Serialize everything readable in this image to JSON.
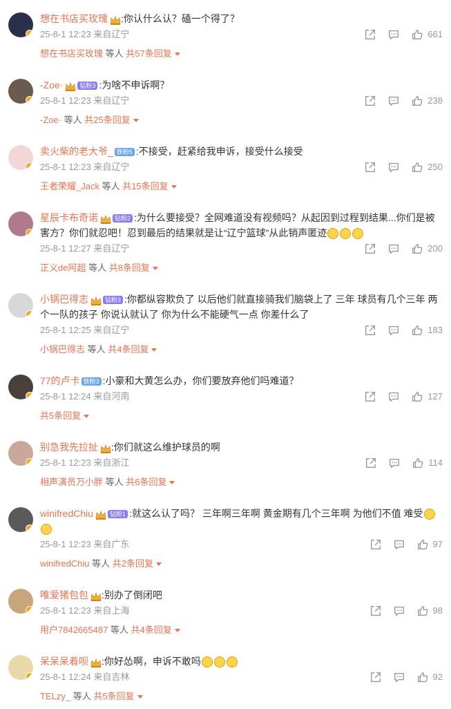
{
  "comments": [
    {
      "user": "想在书店买玫瑰",
      "badge": "",
      "crown": true,
      "text": ":你认什么认？磕一个得了？",
      "emoji_count": 0,
      "meta": "25-8-1 12:23 来自辽宁",
      "likes": "661",
      "reply_user": "想在书店买玫瑰",
      "reply_mid": " 等人 ",
      "reply_count": "共57条回复",
      "avatar_color": "#2a2f4a"
    },
    {
      "user": "-Zoe·",
      "badge": "钻粉3",
      "crown": true,
      "text": ":为啥不申诉啊？",
      "emoji_count": 0,
      "meta": "25-8-1 12:23 来自辽宁",
      "likes": "238",
      "reply_user": "-Zoe·",
      "reply_mid": " 等人 ",
      "reply_count": "共25条回复",
      "avatar_color": "#6b5a4e"
    },
    {
      "user": "卖火柴的老大爷_",
      "badge": "铁粉5",
      "crown": false,
      "text": ":不接受，赶紧给我申诉，接受什么接受",
      "emoji_count": 0,
      "meta": "25-8-1 12:23 来自辽宁",
      "likes": "250",
      "reply_user": "王者荣耀_Jack",
      "reply_mid": " 等人 ",
      "reply_count": "共15条回复",
      "avatar_color": "#f3d6d6"
    },
    {
      "user": "星辰卡布奇诺",
      "badge": "钻粉2",
      "crown": true,
      "text": ":为什么要接受？全网难道没有视频吗？从起因到过程到结果...你们是被害方？你们就忍吧！忍到最后的结果就是让“辽宁篮球”从此销声匿迹",
      "emoji_count": 3,
      "meta": "25-8-1 12:27 来自辽宁",
      "likes": "200",
      "reply_user": "正义de阿超",
      "reply_mid": " 等人 ",
      "reply_count": "共8条回复",
      "avatar_color": "#b07a8e"
    },
    {
      "user": "小锅巴得志",
      "badge": "钻粉3",
      "crown": true,
      "text": ":你都纵容欺负了 以后他们就直接骑我们脑袋上了 三年 球员有几个三年 两个一队的孩子 你说认就认了 你为什么不能硬气一点 你差什么了",
      "emoji_count": 0,
      "meta": "25-8-1 12:25 来自辽宁",
      "likes": "183",
      "reply_user": "小锅巴得志",
      "reply_mid": " 等人 ",
      "reply_count": "共4条回复",
      "avatar_color": "#d8d8d8"
    },
    {
      "user": "77的卢卡",
      "badge": "铁粉3",
      "crown": false,
      "text": ":小豪和大黄怎么办，你们要放弃他们吗难道？",
      "emoji_count": 0,
      "meta": "25-8-1 12:24 来自河南",
      "likes": "127",
      "reply_user": "",
      "reply_mid": "",
      "reply_count": "共5条回复",
      "avatar_color": "#4a3f3a"
    },
    {
      "user": "别急我先拉扯",
      "badge": "",
      "crown": true,
      "text": ":你们就这么维护球员的啊",
      "emoji_count": 0,
      "meta": "25-8-1 12:23 来自浙江",
      "likes": "114",
      "reply_user": "相声演员万小胖",
      "reply_mid": " 等人 ",
      "reply_count": "共6条回复",
      "avatar_color": "#c9a89a"
    },
    {
      "user": "winifredChiu",
      "badge": "钻粉1",
      "crown": true,
      "text": ":就这么认了吗？ 三年啊三年啊 黄金期有几个三年啊 为他们不值 难受",
      "emoji_count": 2,
      "meta": "25-8-1 12:23 来自广东",
      "likes": "97",
      "reply_user": "winifredChiu",
      "reply_mid": " 等人 ",
      "reply_count": "共2条回复",
      "avatar_color": "#5a5a5a"
    },
    {
      "user": "唯爱猪包包",
      "badge": "",
      "crown": true,
      "text": ":别办了倒闭吧",
      "emoji_count": 0,
      "meta": "25-8-1 12:23 来自上海",
      "likes": "98",
      "reply_user": "用户7842665487",
      "reply_mid": " 等人 ",
      "reply_count": "共4条回复",
      "avatar_color": "#c8a57a"
    },
    {
      "user": "呆呆呆着呗",
      "badge": "",
      "crown": true,
      "text": ":你好怂啊，申诉不敢吗",
      "emoji_count": 3,
      "meta": "25-8-1 12:24 来自吉林",
      "likes": "92",
      "reply_user": "TELzy_",
      "reply_mid": " 等人 ",
      "reply_count": "共5条回复",
      "avatar_color": "#e8d9a8"
    }
  ],
  "colors": {
    "accent": "#eb7350",
    "meta": "#999999",
    "text": "#333333"
  },
  "icons": {
    "share": "share-icon",
    "comment": "comment-icon",
    "like": "like-icon"
  }
}
